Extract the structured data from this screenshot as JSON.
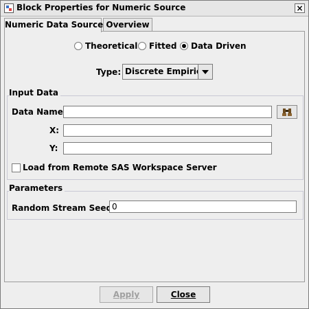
{
  "window": {
    "title": "Block Properties for Numeric Source",
    "close_glyph": "×"
  },
  "tabs": [
    {
      "label": "Numeric Data Source",
      "active": true
    },
    {
      "label": "Overview",
      "active": false
    }
  ],
  "source_options": [
    {
      "label": "Theoretical",
      "selected": false
    },
    {
      "label": "Fitted",
      "selected": false
    },
    {
      "label": "Data Driven",
      "selected": true
    }
  ],
  "type": {
    "label": "Type:",
    "value": "Discrete Empirical"
  },
  "input_data": {
    "title": "Input Data",
    "data_name": {
      "label": "Data Name:",
      "value": ""
    },
    "x": {
      "label": "X:",
      "value": ""
    },
    "y": {
      "label": "Y:",
      "value": ""
    },
    "load_remote": {
      "label": "Load from Remote SAS Workspace Server",
      "checked": false
    }
  },
  "parameters": {
    "title": "Parameters",
    "seed": {
      "label": "Random Stream Seed :",
      "value": "0"
    }
  },
  "buttons": {
    "apply": "Apply",
    "close": "Close"
  },
  "icons": {
    "window": "app-icon",
    "browse": "binoculars-icon",
    "dropdown": "chevron-down-icon"
  }
}
